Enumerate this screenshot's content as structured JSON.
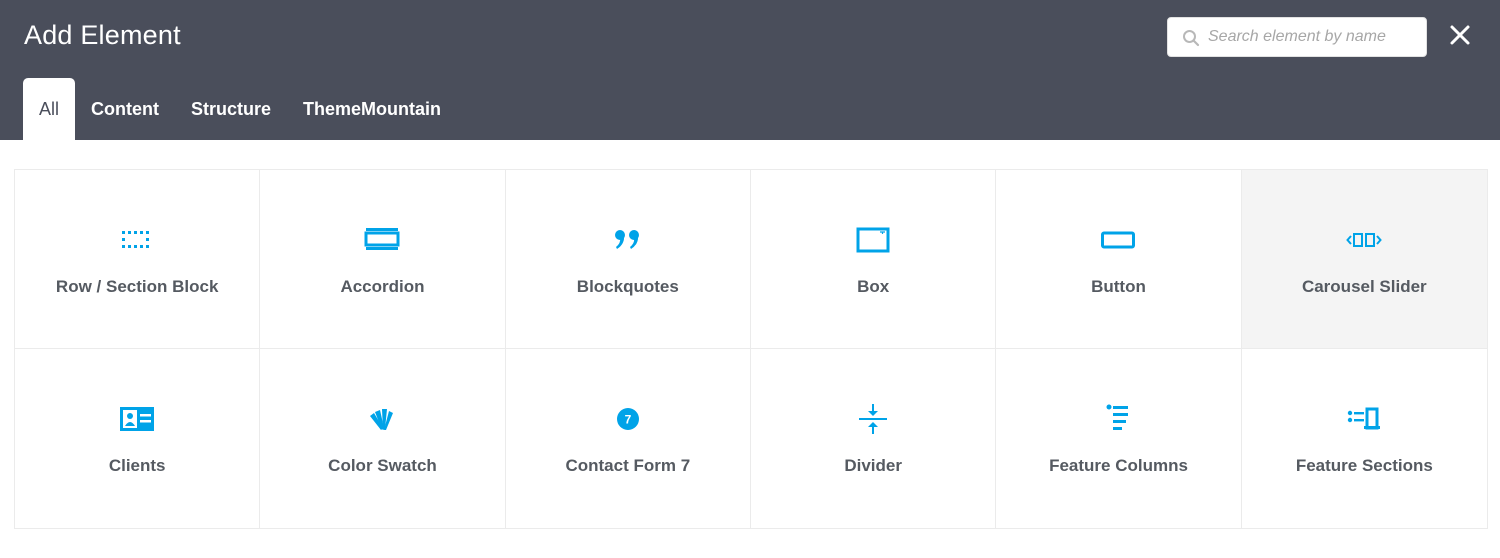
{
  "header": {
    "title": "Add Element",
    "search_placeholder": "Search element by name"
  },
  "tabs": [
    {
      "label": "All",
      "active": true
    },
    {
      "label": "Content",
      "active": false
    },
    {
      "label": "Structure",
      "active": false
    },
    {
      "label": "ThemeMountain",
      "active": false
    }
  ],
  "accent_color": "#00a3e8",
  "elements": [
    {
      "label": "Row / Section Block",
      "icon": "row-section-icon"
    },
    {
      "label": "Accordion",
      "icon": "accordion-icon"
    },
    {
      "label": "Blockquotes",
      "icon": "quote-icon"
    },
    {
      "label": "Box",
      "icon": "box-icon"
    },
    {
      "label": "Button",
      "icon": "button-icon"
    },
    {
      "label": "Carousel Slider",
      "icon": "carousel-icon"
    },
    {
      "label": "Clients",
      "icon": "client-card-icon"
    },
    {
      "label": "Color Swatch",
      "icon": "color-swatch-icon"
    },
    {
      "label": "Contact Form 7",
      "icon": "contact-form-icon",
      "icon_text": "7"
    },
    {
      "label": "Divider",
      "icon": "divider-icon"
    },
    {
      "label": "Feature Columns",
      "icon": "feature-columns-icon"
    },
    {
      "label": "Feature Sections",
      "icon": "feature-sections-icon"
    }
  ]
}
